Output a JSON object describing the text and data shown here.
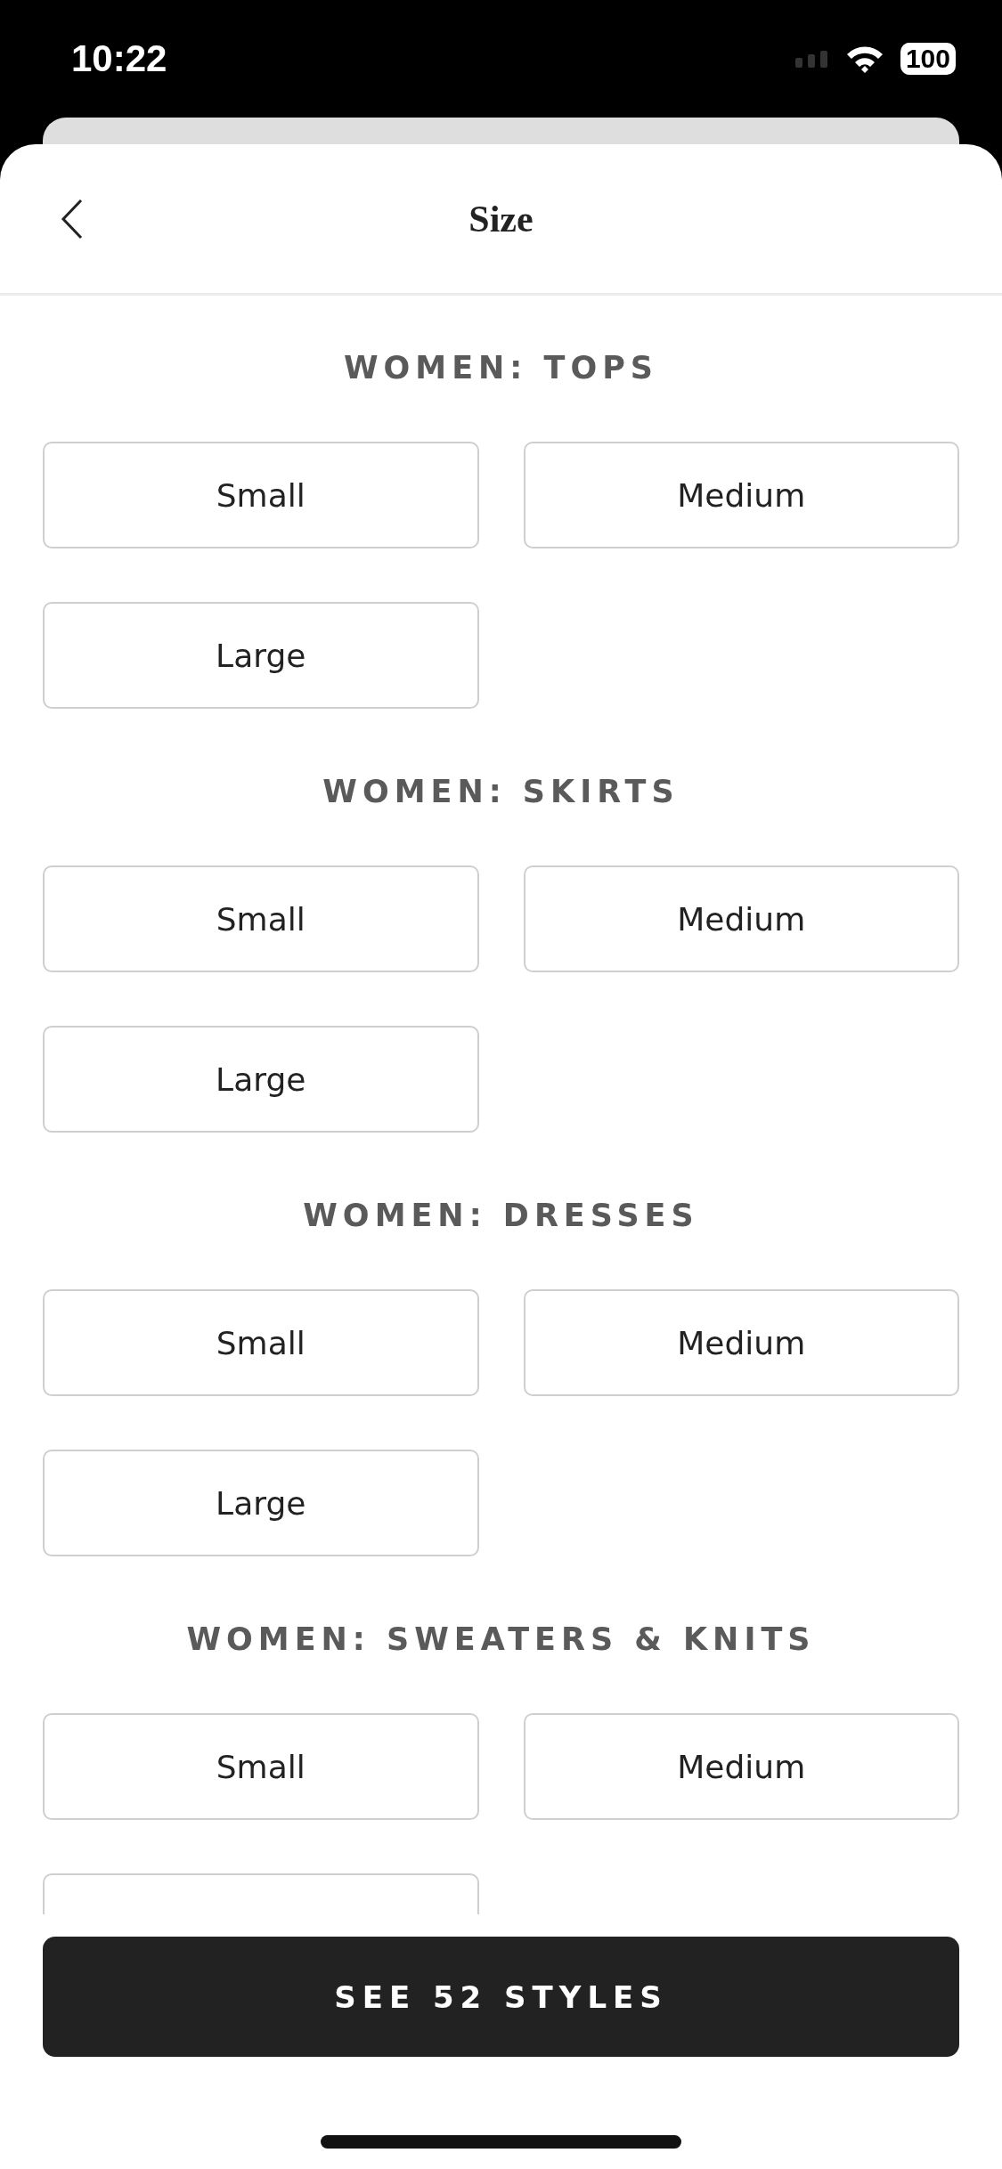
{
  "status_bar": {
    "time": "10:22",
    "battery": "100"
  },
  "header": {
    "title": "Size"
  },
  "sections": [
    {
      "title": "WOMEN: TOPS",
      "options": [
        {
          "label": "Small",
          "selected": false
        },
        {
          "label": "Medium",
          "selected": false
        },
        {
          "label": "Large",
          "selected": false
        }
      ]
    },
    {
      "title": "WOMEN: SKIRTS",
      "options": [
        {
          "label": "Small",
          "selected": false
        },
        {
          "label": "Medium",
          "selected": false
        },
        {
          "label": "Large",
          "selected": false
        }
      ]
    },
    {
      "title": "WOMEN: DRESSES",
      "options": [
        {
          "label": "Small",
          "selected": false
        },
        {
          "label": "Medium",
          "selected": false
        },
        {
          "label": "Large",
          "selected": false
        }
      ]
    },
    {
      "title": "WOMEN: SWEATERS & KNITS",
      "options": [
        {
          "label": "Small",
          "selected": false
        },
        {
          "label": "Medium",
          "selected": false
        },
        {
          "selected": false
        }
      ]
    }
  ],
  "footer": {
    "button": "SEE 52 STYLES"
  }
}
